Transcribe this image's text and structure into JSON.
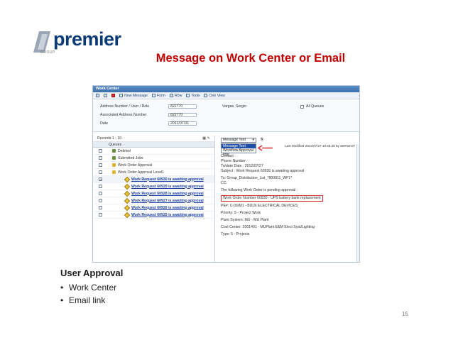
{
  "logo": {
    "text": "premier",
    "sub": "GROUP"
  },
  "slide": {
    "title": "Message on Work Center or Email",
    "section_title": "User Approval",
    "bullets": [
      "Work Center",
      "Email link"
    ],
    "page_number": "15"
  },
  "screenshot": {
    "window_title": "Work Center",
    "toolbar": [
      "New Message",
      "Form",
      "Row",
      "Tools",
      "One View"
    ],
    "form": {
      "address_label": "Address Number / User / Role",
      "address_value": "822770",
      "name_value": "Vargas, Sergio",
      "assoc_label": "Associated Address Number",
      "assoc_value": "822770",
      "date_label": "Date",
      "date_value": "2012/07/31",
      "all_queues_label": "All Queues"
    },
    "records_label": "Records 1 - 10",
    "queues_header": "Queues",
    "tree": [
      {
        "label": "Deleted",
        "level": 1
      },
      {
        "label": "Submitted Jobs",
        "level": 1
      },
      {
        "label": "Work Order Approval",
        "level": 1
      },
      {
        "label": "Work Order Approval Level1",
        "level": 1
      },
      {
        "label": "Work Request 60930 is awaiting approval",
        "level": 2
      },
      {
        "label": "Work Request 60929 is awaiting approval",
        "level": 2
      },
      {
        "label": "Work Request 60928 is awaiting approval",
        "level": 2
      },
      {
        "label": "Work Request 60927 is awaiting approval",
        "level": 2
      },
      {
        "label": "Work Request 60926 is awaiting approval",
        "level": 2
      },
      {
        "label": "Work Request 60925 is awaiting approval",
        "level": 2
      }
    ],
    "message_select": "Message Text",
    "dropdown_options": [
      "Message Text",
      "Workflow Approval Info"
    ],
    "last_modified": "Last Modified 2012/07/27 10:45:26 by SERGIOV",
    "message_lines": [
      "Contact :",
      "Phone Number :",
      "To/date Date : 2012/07/27",
      "Subject : Work Request 60930 is awaiting approval",
      "",
      "To: Group_Distribution_List_*800011_WF1*",
      "CC:",
      "",
      "The following Work Order is pending approval :",
      "",
      "Work Order Number 60930 - UPS battery bank replacement",
      "",
      "PE#: C-06/M1 - BULK ELECTRICAL DEVICES",
      "",
      "Priority: 5 - Project Work",
      "",
      "Plant System: MU - MU Plant",
      "",
      "Cost Center: 2001401 - MUPlant E&M Elect Syst/Lighting",
      "",
      "Type: 5 - Projects"
    ]
  }
}
